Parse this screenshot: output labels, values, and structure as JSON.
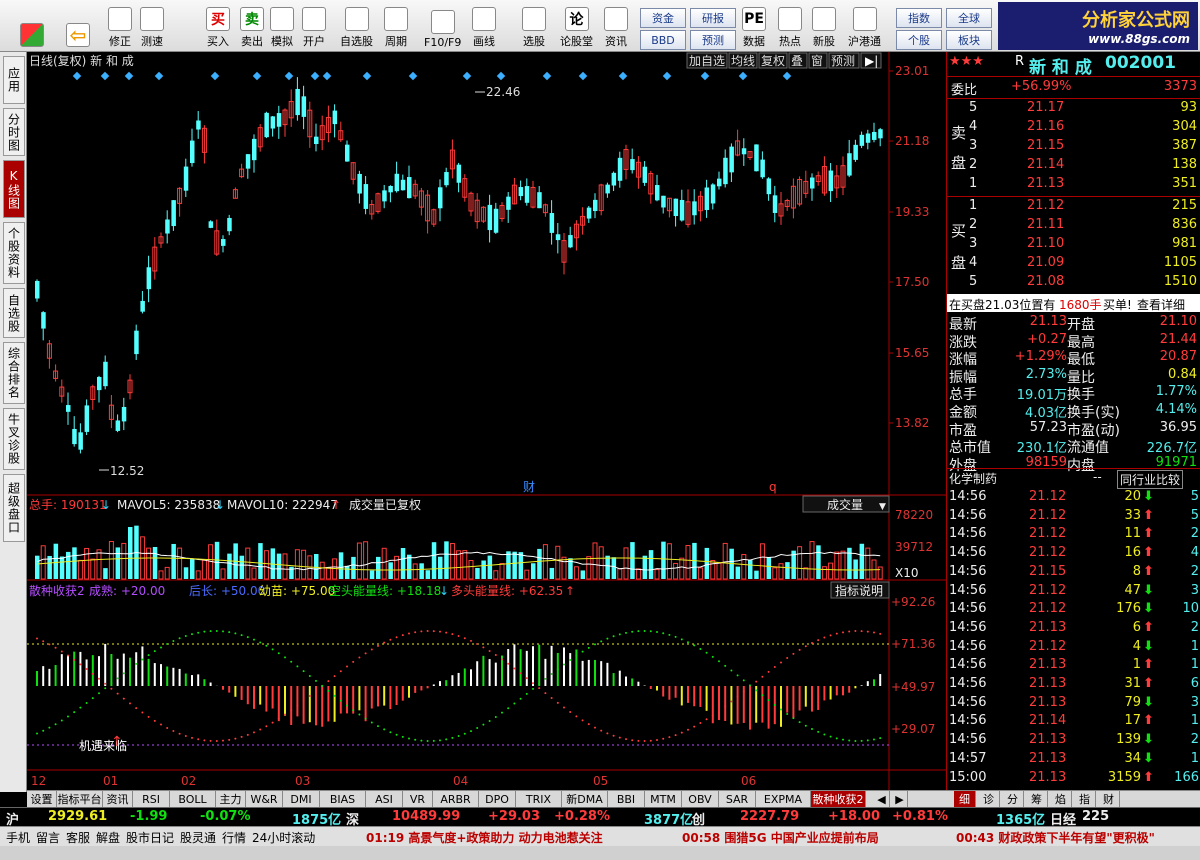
{
  "toolbar": {
    "buttons": [
      {
        "label": "修正",
        "icon": "up-arrow-icon"
      },
      {
        "label": "测速",
        "icon": "clock-icon"
      },
      {
        "label": "买入",
        "icon": "buy-icon",
        "glyph": "买"
      },
      {
        "label": "卖出",
        "icon": "sell-icon",
        "glyph": "卖"
      },
      {
        "label": "模拟",
        "icon": "hammer-icon"
      },
      {
        "label": "开户",
        "icon": "lock-icon"
      },
      {
        "label": "自选股",
        "icon": "watchlist-icon"
      },
      {
        "label": "周期",
        "icon": "period-icon"
      },
      {
        "label": "F10/F9",
        "icon": "f10-icon"
      },
      {
        "label": "画线",
        "icon": "pen-icon"
      },
      {
        "label": "选股",
        "icon": "select-stock-icon"
      },
      {
        "label": "论股堂",
        "icon": "forum-icon",
        "glyph": "论"
      },
      {
        "label": "资讯",
        "icon": "info-icon"
      },
      {
        "label": "数据",
        "icon": "data-icon",
        "glyph": "PE"
      },
      {
        "label": "热点",
        "icon": "hot-icon"
      },
      {
        "label": "新股",
        "icon": "new-stock-icon"
      },
      {
        "label": "沪港通",
        "icon": "hk-connect-icon"
      }
    ],
    "small_buttons": [
      "资金",
      "研报",
      "BBD",
      "预测",
      "指数",
      "全球",
      "个股",
      "板块"
    ]
  },
  "logo": {
    "title": "分析家公式网",
    "url": "www.88gs.com"
  },
  "left_tabs": [
    "应用",
    "分时图",
    "K线图",
    "个股资料",
    "自选股",
    "综合排名",
    "牛叉诊股",
    "超级盘口"
  ],
  "chart": {
    "title": "日线(复权) 新 和 成",
    "top_buttons": [
      "加自选",
      "均线",
      "复权",
      "叠",
      "窗",
      "预测"
    ],
    "price_axis": [
      "23.01",
      "21.18",
      "19.33",
      "17.50",
      "15.65",
      "13.82"
    ],
    "high_label": "22.46",
    "low_label": "12.52",
    "marker_cai": "财",
    "marker_q": "q",
    "vol_header": {
      "total": "总手: 190131",
      "mavol5": "MAVOL5: 235838",
      "mavol10": "MAVOL10: 222947",
      "note": "成交量已复权",
      "dropdown": "成交量"
    },
    "vol_axis": [
      "78220",
      "39712",
      "X10"
    ],
    "ind_header": {
      "name": "散种收获2",
      "cj": "成熟: +20.00",
      "gz": "后长: +50.00",
      "ym": "幼苗: +75.00",
      "kt": "空头能量线: +18.18",
      "dt": "多头能量线: +62.35",
      "btn": "指标说明"
    },
    "ind_axis": [
      "+92.26",
      "+71.36",
      "+49.97",
      "+29.07"
    ],
    "opportunity": "机遇来临",
    "months": [
      "12",
      "01",
      "02",
      "03",
      "04",
      "05",
      "06"
    ]
  },
  "quote": {
    "stars": "★★★",
    "r": "R",
    "name": "新 和 成",
    "code": "002001",
    "wb_label": "委比",
    "wb_pct": "+56.99%",
    "wb_val": "3373",
    "sell_label": [
      "卖",
      "盘"
    ],
    "buy_label": [
      "买",
      "盘"
    ],
    "sell": [
      {
        "n": "5",
        "p": "21.17",
        "v": "93"
      },
      {
        "n": "4",
        "p": "21.16",
        "v": "304"
      },
      {
        "n": "3",
        "p": "21.15",
        "v": "387"
      },
      {
        "n": "2",
        "p": "21.14",
        "v": "138"
      },
      {
        "n": "1",
        "p": "21.13",
        "v": "351"
      }
    ],
    "buy": [
      {
        "n": "1",
        "p": "21.12",
        "v": "215"
      },
      {
        "n": "2",
        "p": "21.11",
        "v": "836"
      },
      {
        "n": "3",
        "p": "21.10",
        "v": "981"
      },
      {
        "n": "4",
        "p": "21.09",
        "v": "1105"
      },
      {
        "n": "5",
        "p": "21.08",
        "v": "1510"
      }
    ],
    "notice_a": "在买盘21.03位置有",
    "notice_b": "1680手",
    "notice_c": "买单!",
    "notice_d": "查看详细",
    "stats": [
      {
        "l1": "最新",
        "v1": "21.13",
        "c1": "red",
        "l2": "开盘",
        "v2": "21.10",
        "c2": "red"
      },
      {
        "l1": "涨跌",
        "v1": "+0.27",
        "c1": "red",
        "l2": "最高",
        "v2": "21.44",
        "c2": "red"
      },
      {
        "l1": "涨幅",
        "v1": "+1.29%",
        "c1": "red",
        "l2": "最低",
        "v2": "20.87",
        "c2": "red"
      },
      {
        "l1": "振幅",
        "v1": "2.73%",
        "c1": "cyan",
        "l2": "量比",
        "v2": "0.84",
        "c2": "yellow"
      },
      {
        "l1": "总手",
        "v1": "19.01万",
        "c1": "cyan",
        "l2": "换手",
        "v2": "1.77%",
        "c2": "cyan"
      },
      {
        "l1": "金额",
        "v1": "4.03亿",
        "c1": "cyan",
        "l2": "换手(实)",
        "v2": "4.14%",
        "c2": "cyan"
      },
      {
        "l1": "市盈",
        "v1": "57.23",
        "c1": "white",
        "l2": "市盈(动)",
        "v2": "36.95",
        "c2": "white"
      },
      {
        "l1": "总市值",
        "v1": "230.1亿",
        "c1": "cyan",
        "l2": "流通值",
        "v2": "226.7亿",
        "c2": "cyan"
      },
      {
        "l1": "外盘",
        "v1": "98159",
        "c1": "red",
        "l2": "内盘",
        "v2": "91971",
        "c2": "green"
      }
    ],
    "industry": "化学制药",
    "industry_dash": "--",
    "compare": "同行业比较",
    "ticks": [
      {
        "t": "14:56",
        "p": "21.12",
        "v": "20",
        "d": "down",
        "x": "5"
      },
      {
        "t": "14:56",
        "p": "21.12",
        "v": "33",
        "d": "up",
        "x": "5"
      },
      {
        "t": "14:56",
        "p": "21.12",
        "v": "11",
        "d": "up",
        "x": "2"
      },
      {
        "t": "14:56",
        "p": "21.12",
        "v": "16",
        "d": "up",
        "x": "4"
      },
      {
        "t": "14:56",
        "p": "21.15",
        "v": "8",
        "d": "up",
        "x": "2"
      },
      {
        "t": "14:56",
        "p": "21.12",
        "v": "47",
        "d": "down",
        "x": "3"
      },
      {
        "t": "14:56",
        "p": "21.12",
        "v": "176",
        "d": "down",
        "x": "10"
      },
      {
        "t": "14:56",
        "p": "21.13",
        "v": "6",
        "d": "up",
        "x": "2"
      },
      {
        "t": "14:56",
        "p": "21.12",
        "v": "4",
        "d": "down",
        "x": "1"
      },
      {
        "t": "14:56",
        "p": "21.13",
        "v": "1",
        "d": "up",
        "x": "1"
      },
      {
        "t": "14:56",
        "p": "21.13",
        "v": "31",
        "d": "up",
        "x": "6"
      },
      {
        "t": "14:56",
        "p": "21.13",
        "v": "79",
        "d": "down",
        "x": "3"
      },
      {
        "t": "14:56",
        "p": "21.14",
        "v": "17",
        "d": "up",
        "x": "1"
      },
      {
        "t": "14:56",
        "p": "21.13",
        "v": "139",
        "d": "down",
        "x": "2"
      },
      {
        "t": "14:57",
        "p": "21.13",
        "v": "34",
        "d": "down",
        "x": "1"
      },
      {
        "t": "15:00",
        "p": "21.13",
        "v": "3159",
        "d": "up",
        "x": "166"
      }
    ]
  },
  "bottom_tabs": [
    "设置",
    "指标平台",
    "资讯",
    "RSI",
    "BOLL",
    "主力",
    "W&R",
    "DMI",
    "BIAS",
    "ASI",
    "VR",
    "ARBR",
    "DPO",
    "TRIX",
    "新DMA",
    "BBI",
    "MTM",
    "OBV",
    "SAR",
    "EXPMA",
    "散种收获2"
  ],
  "right_bottom_tabs": [
    "细",
    "诊",
    "分",
    "筹",
    "焰",
    "指",
    "财"
  ],
  "status": {
    "sh_label": "沪",
    "sh_idx": "2929.61",
    "sh_chg": "-1.99",
    "sh_pct": "-0.07%",
    "sh_amt": "1875亿",
    "sz_label": "深",
    "sz_idx": "10489.99",
    "sz_chg": "+29.03",
    "sz_pct": "+0.28%",
    "sz_amt": "3877亿",
    "cy_label": "创",
    "cy_idx": "2227.79",
    "cy_chg": "+18.00",
    "cy_pct": "+0.81%",
    "cy_amt": "1365亿",
    "rj_label": "日经",
    "rj_idx": "225"
  },
  "news": {
    "links": [
      "手机",
      "留言",
      "客服",
      "解盘",
      "股市日记",
      "股灵通",
      "行情",
      "24小时滚动"
    ],
    "n1": "01:19 高景气度+政策助力 动力电池惹关注",
    "n2": "00:58 围猎5G 中国产业应提前布局",
    "n3": "00:43 财政政策下半年有望\"更积极\""
  }
}
